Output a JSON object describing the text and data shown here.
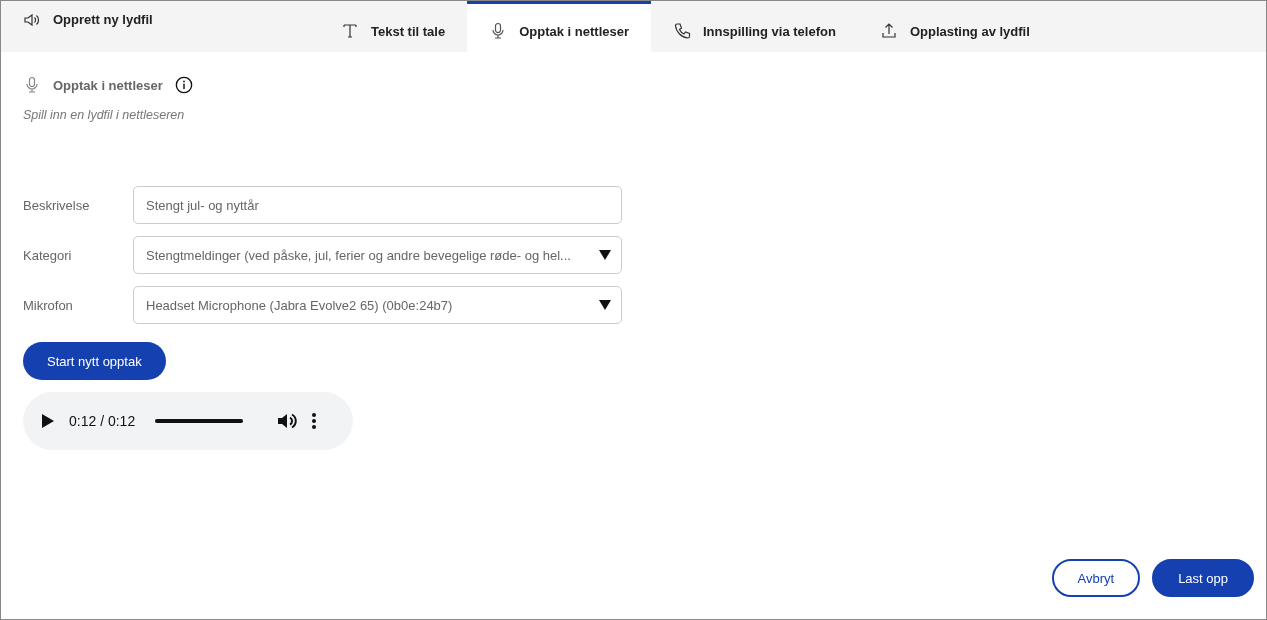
{
  "header": {
    "title": "Opprett ny lydfil"
  },
  "tabs": [
    {
      "label": "Tekst til tale",
      "kind": "text",
      "selected": false
    },
    {
      "label": "Opptak i nettleser",
      "kind": "mic",
      "selected": true
    },
    {
      "label": "Innspilling via telefon",
      "kind": "phone",
      "selected": false
    },
    {
      "label": "Opplasting av lydfil",
      "kind": "upload",
      "selected": false
    }
  ],
  "section": {
    "title": "Opptak i nettleser",
    "subtitle": "Spill inn en lydfil i nettleseren"
  },
  "form": [
    {
      "label": "Beskrivelse",
      "kind": "text",
      "value": "Stengt jul- og nyttår"
    },
    {
      "label": "Kategori",
      "kind": "select",
      "value": "Stengtmeldinger (ved påske, jul, ferier og andre bevegelige røde- og hel..."
    },
    {
      "label": "Mikrofon",
      "kind": "select",
      "value": "Headset Microphone (Jabra Evolve2 65) (0b0e:24b7)"
    }
  ],
  "record_button": "Start nytt opptak",
  "player": {
    "time": "0:12 / 0:12",
    "level": 1
  },
  "buttons": [
    {
      "label": "Avbryt",
      "kind": "secondary"
    },
    {
      "label": "Last opp",
      "kind": "primary"
    }
  ]
}
